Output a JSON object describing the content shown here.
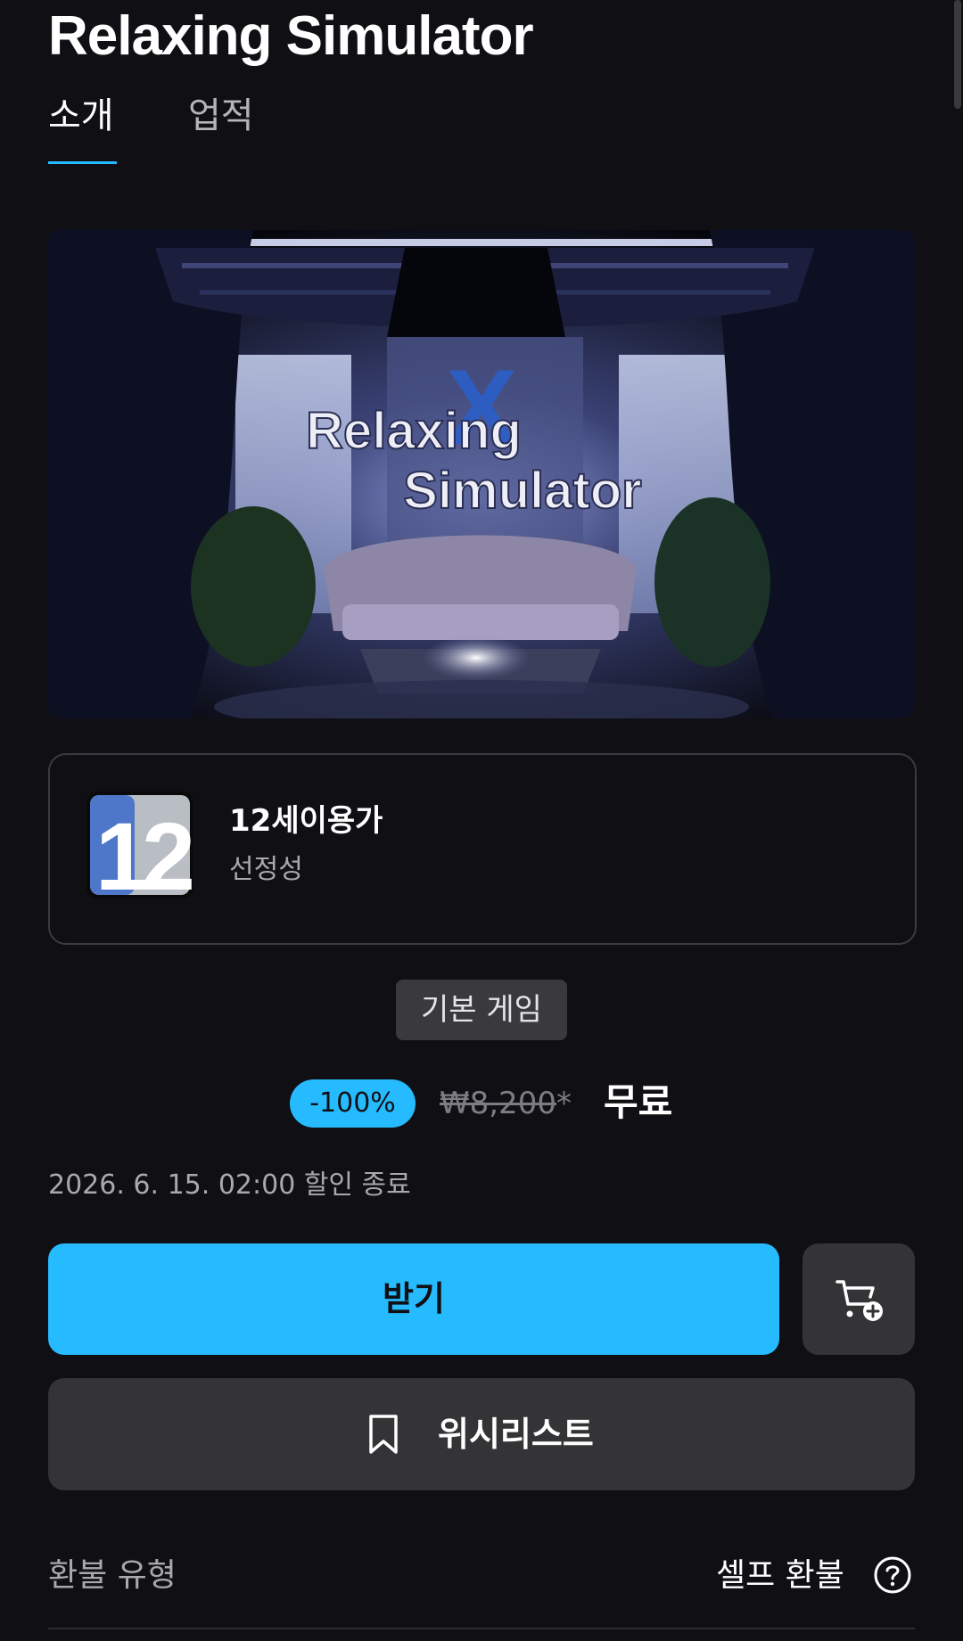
{
  "game": {
    "title": "Relaxing Simulator",
    "hero_logo_line1": "Relaxing",
    "hero_logo_line2": "Simulator",
    "hero_logo_mark": "X"
  },
  "tabs": [
    {
      "label": "소개",
      "active": true
    },
    {
      "label": "업적",
      "active": false
    }
  ],
  "rating": {
    "icon_text": "12",
    "name": "12세이용가",
    "descriptor": "선정성"
  },
  "edition_badge": "기본 게임",
  "price": {
    "discount": "-100%",
    "original": "₩8,200",
    "original_suffix": "*",
    "final": "무료"
  },
  "sale_end": "2026. 6. 15. 02:00 할인 종료",
  "actions": {
    "get_label": "받기",
    "cart_icon": "cart-add-icon",
    "wishlist_label": "위시리스트",
    "wishlist_icon": "bookmark-icon"
  },
  "refund": {
    "label": "환불 유형",
    "value": "셀프 환불",
    "help_icon": "question-circle-icon"
  },
  "colors": {
    "background": "#101014",
    "accent": "#26bbff",
    "button_secondary": "#343437"
  }
}
